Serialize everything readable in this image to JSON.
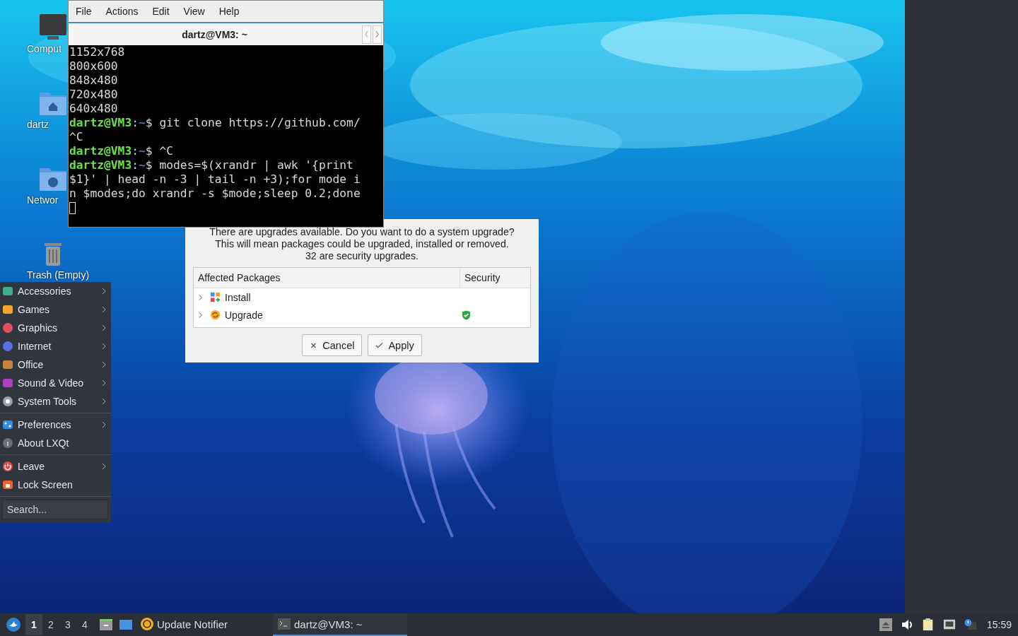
{
  "desktop": {
    "icons": [
      {
        "label": "Comput",
        "kind": "computer"
      },
      {
        "label": "dartz",
        "kind": "home"
      },
      {
        "label": "Networ",
        "kind": "network"
      },
      {
        "label": "Trash (Empty)",
        "kind": "trash"
      }
    ]
  },
  "terminal": {
    "menu": [
      "File",
      "Actions",
      "Edit",
      "View",
      "Help"
    ],
    "tab_title": "dartz@VM3: ~",
    "lines": [
      {
        "kind": "output",
        "text": "1152x768"
      },
      {
        "kind": "output",
        "text": "800x600"
      },
      {
        "kind": "output",
        "text": "848x480"
      },
      {
        "kind": "output",
        "text": "720x480"
      },
      {
        "kind": "output",
        "text": "640x480"
      },
      {
        "kind": "prompt",
        "host": "dartz@VM3",
        "sep": ":",
        "dir": "~",
        "sign": "$",
        "text": "git clone https://github.com/"
      },
      {
        "kind": "output",
        "text": "^C"
      },
      {
        "kind": "prompt",
        "host": "dartz@VM3",
        "sep": ":",
        "dir": "~",
        "sign": "$",
        "text": "^C"
      },
      {
        "kind": "prompt",
        "host": "dartz@VM3",
        "sep": ":",
        "dir": "~",
        "sign": "$",
        "text": "modes=$(xrandr | awk '{print"
      },
      {
        "kind": "output",
        "text": "$1}' | head -n -3 | tail -n +3);for mode i"
      },
      {
        "kind": "output",
        "text": "n $modes;do xrandr -s $mode;sleep 0.2;done"
      },
      {
        "kind": "cursor"
      }
    ]
  },
  "dialog": {
    "message": [
      "There are upgrades available. Do you want to do a system upgrade?",
      "This will mean packages could be upgraded, installed or removed.",
      "32 are security upgrades."
    ],
    "columns": [
      "Affected Packages",
      "Security"
    ],
    "rows": [
      {
        "label": "Install",
        "kind": "install",
        "expanded": false,
        "security": false
      },
      {
        "label": "Upgrade",
        "kind": "upgrade",
        "expanded": false,
        "security": true
      }
    ],
    "buttons": [
      {
        "label": "Cancel",
        "kind": "cancel"
      },
      {
        "label": "Apply",
        "kind": "apply"
      }
    ]
  },
  "menu": {
    "groups": [
      [
        {
          "label": "Accessories",
          "kind": "accessories",
          "submenu": true
        },
        {
          "label": "Games",
          "kind": "games",
          "submenu": true
        },
        {
          "label": "Graphics",
          "kind": "graphics",
          "submenu": true
        },
        {
          "label": "Internet",
          "kind": "internet",
          "submenu": true
        },
        {
          "label": "Office",
          "kind": "office",
          "submenu": true
        },
        {
          "label": "Sound & Video",
          "kind": "media",
          "submenu": true
        },
        {
          "label": "System Tools",
          "kind": "system",
          "submenu": true
        }
      ],
      [
        {
          "label": "Preferences",
          "kind": "preferences",
          "submenu": true
        },
        {
          "label": "About LXQt",
          "kind": "about",
          "submenu": false
        }
      ],
      [
        {
          "label": "Leave",
          "kind": "leave",
          "submenu": true
        },
        {
          "label": "Lock Screen",
          "kind": "lock",
          "submenu": false
        }
      ]
    ],
    "search": {
      "placeholder": "Search..."
    }
  },
  "taskbar": {
    "desktops": [
      {
        "label": "1",
        "selected": true
      },
      {
        "label": "2",
        "selected": false
      },
      {
        "label": "3",
        "selected": false
      },
      {
        "label": "4",
        "selected": false
      }
    ],
    "tasks": [
      {
        "label": "Update Notifier",
        "kind": "updater",
        "selected": false
      },
      {
        "label": "dartz@VM3: ~",
        "kind": "terminal",
        "selected": true
      }
    ],
    "clock": "15:59"
  }
}
